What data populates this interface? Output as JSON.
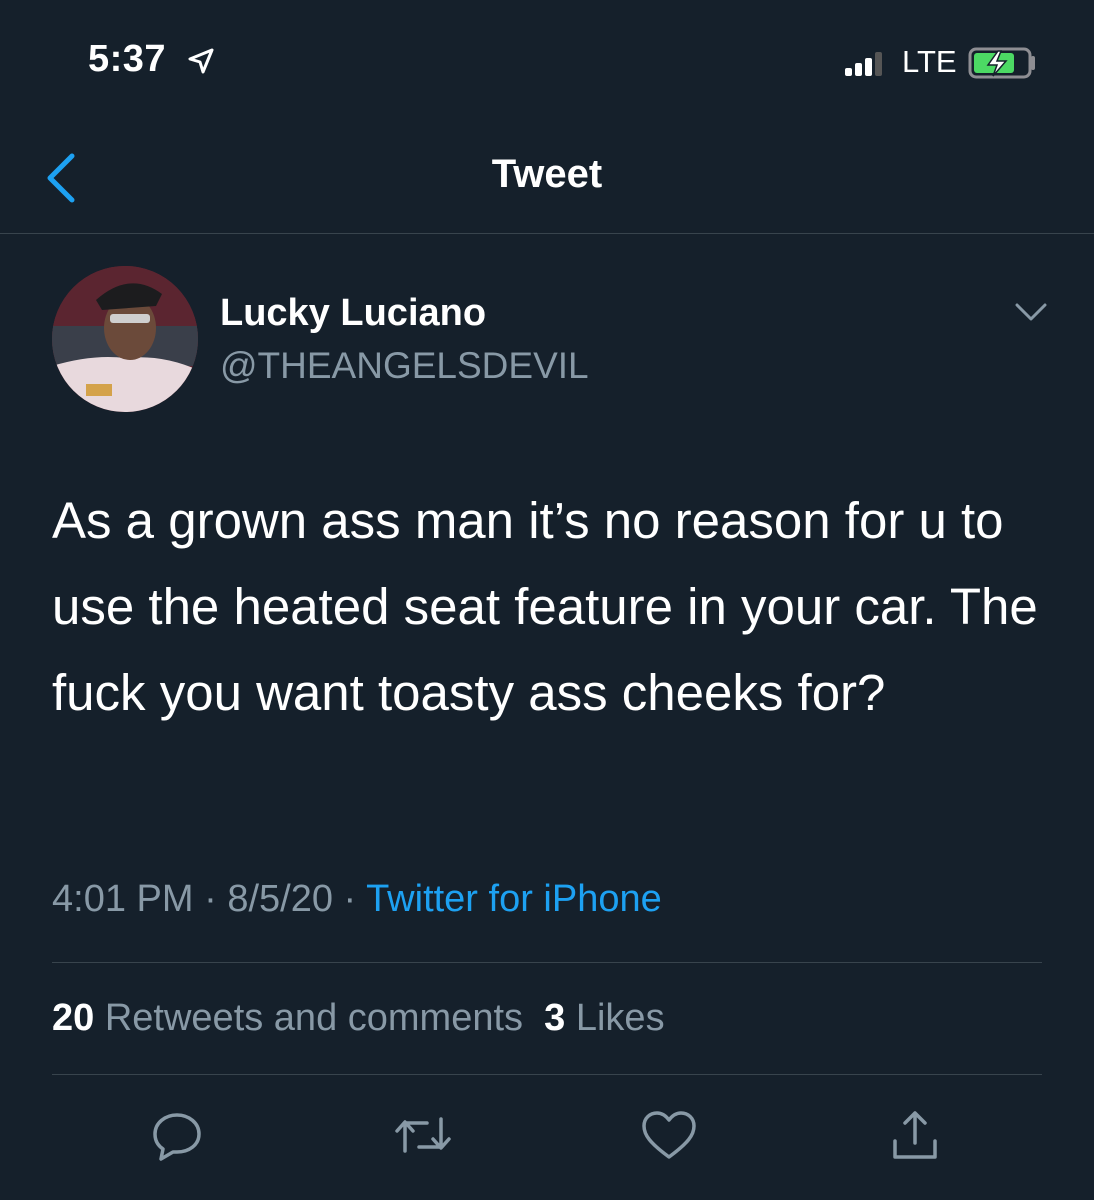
{
  "status_bar": {
    "time": "5:37",
    "network": "LTE"
  },
  "nav": {
    "title": "Tweet"
  },
  "tweet": {
    "display_name": "Lucky Luciano",
    "handle": "@THEANGELSDEVIL",
    "text": "As a grown ass man it’s no reason for u to use the heated seat feature in your car. The fuck you want toasty ass cheeks for?",
    "time": "4:01 PM",
    "date": "8/5/20",
    "separator": "·",
    "source": "Twitter for iPhone",
    "retweets_count": "20",
    "retweets_label": "Retweets and comments",
    "likes_count": "3",
    "likes_label": "Likes"
  },
  "colors": {
    "background": "#15202b",
    "accent": "#1da1f2",
    "secondary_text": "#8899a6",
    "divider": "#38444d"
  },
  "icons": [
    "location-arrow-icon",
    "signal-icon",
    "battery-charging-icon",
    "back-chevron-icon",
    "chevron-down-icon",
    "reply-icon",
    "retweet-icon",
    "like-icon",
    "share-icon"
  ]
}
